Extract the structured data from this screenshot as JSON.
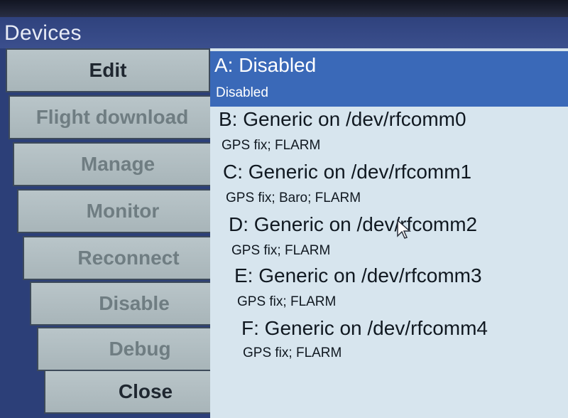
{
  "window": {
    "title": "Devices"
  },
  "buttons": [
    {
      "label": "Edit",
      "enabled": true
    },
    {
      "label": "Flight download",
      "enabled": false
    },
    {
      "label": "Manage",
      "enabled": false
    },
    {
      "label": "Monitor",
      "enabled": false
    },
    {
      "label": "Reconnect",
      "enabled": false
    },
    {
      "label": "Disable",
      "enabled": false
    },
    {
      "label": "Debug",
      "enabled": false
    },
    {
      "label": "Close",
      "enabled": true
    }
  ],
  "devices": [
    {
      "name": "A: Disabled",
      "status": "Disabled",
      "selected": true
    },
    {
      "name": "B: Generic on /dev/rfcomm0",
      "status": "GPS fix; FLARM",
      "selected": false
    },
    {
      "name": "C: Generic on /dev/rfcomm1",
      "status": "GPS fix; Baro; FLARM",
      "selected": false
    },
    {
      "name": "D: Generic on /dev/rfcomm2",
      "status": "GPS fix; FLARM",
      "selected": false
    },
    {
      "name": "E: Generic on /dev/rfcomm3",
      "status": "GPS fix; FLARM",
      "selected": false
    },
    {
      "name": "F: Generic on /dev/rfcomm4",
      "status": "GPS fix; FLARM",
      "selected": false
    }
  ],
  "colors": {
    "selection": "#3a69b8",
    "list_background": "#d7e5ee",
    "button_face": "#b0bcc0",
    "button_disabled_text": "#6f7d82",
    "title_bar": "#34478a"
  }
}
